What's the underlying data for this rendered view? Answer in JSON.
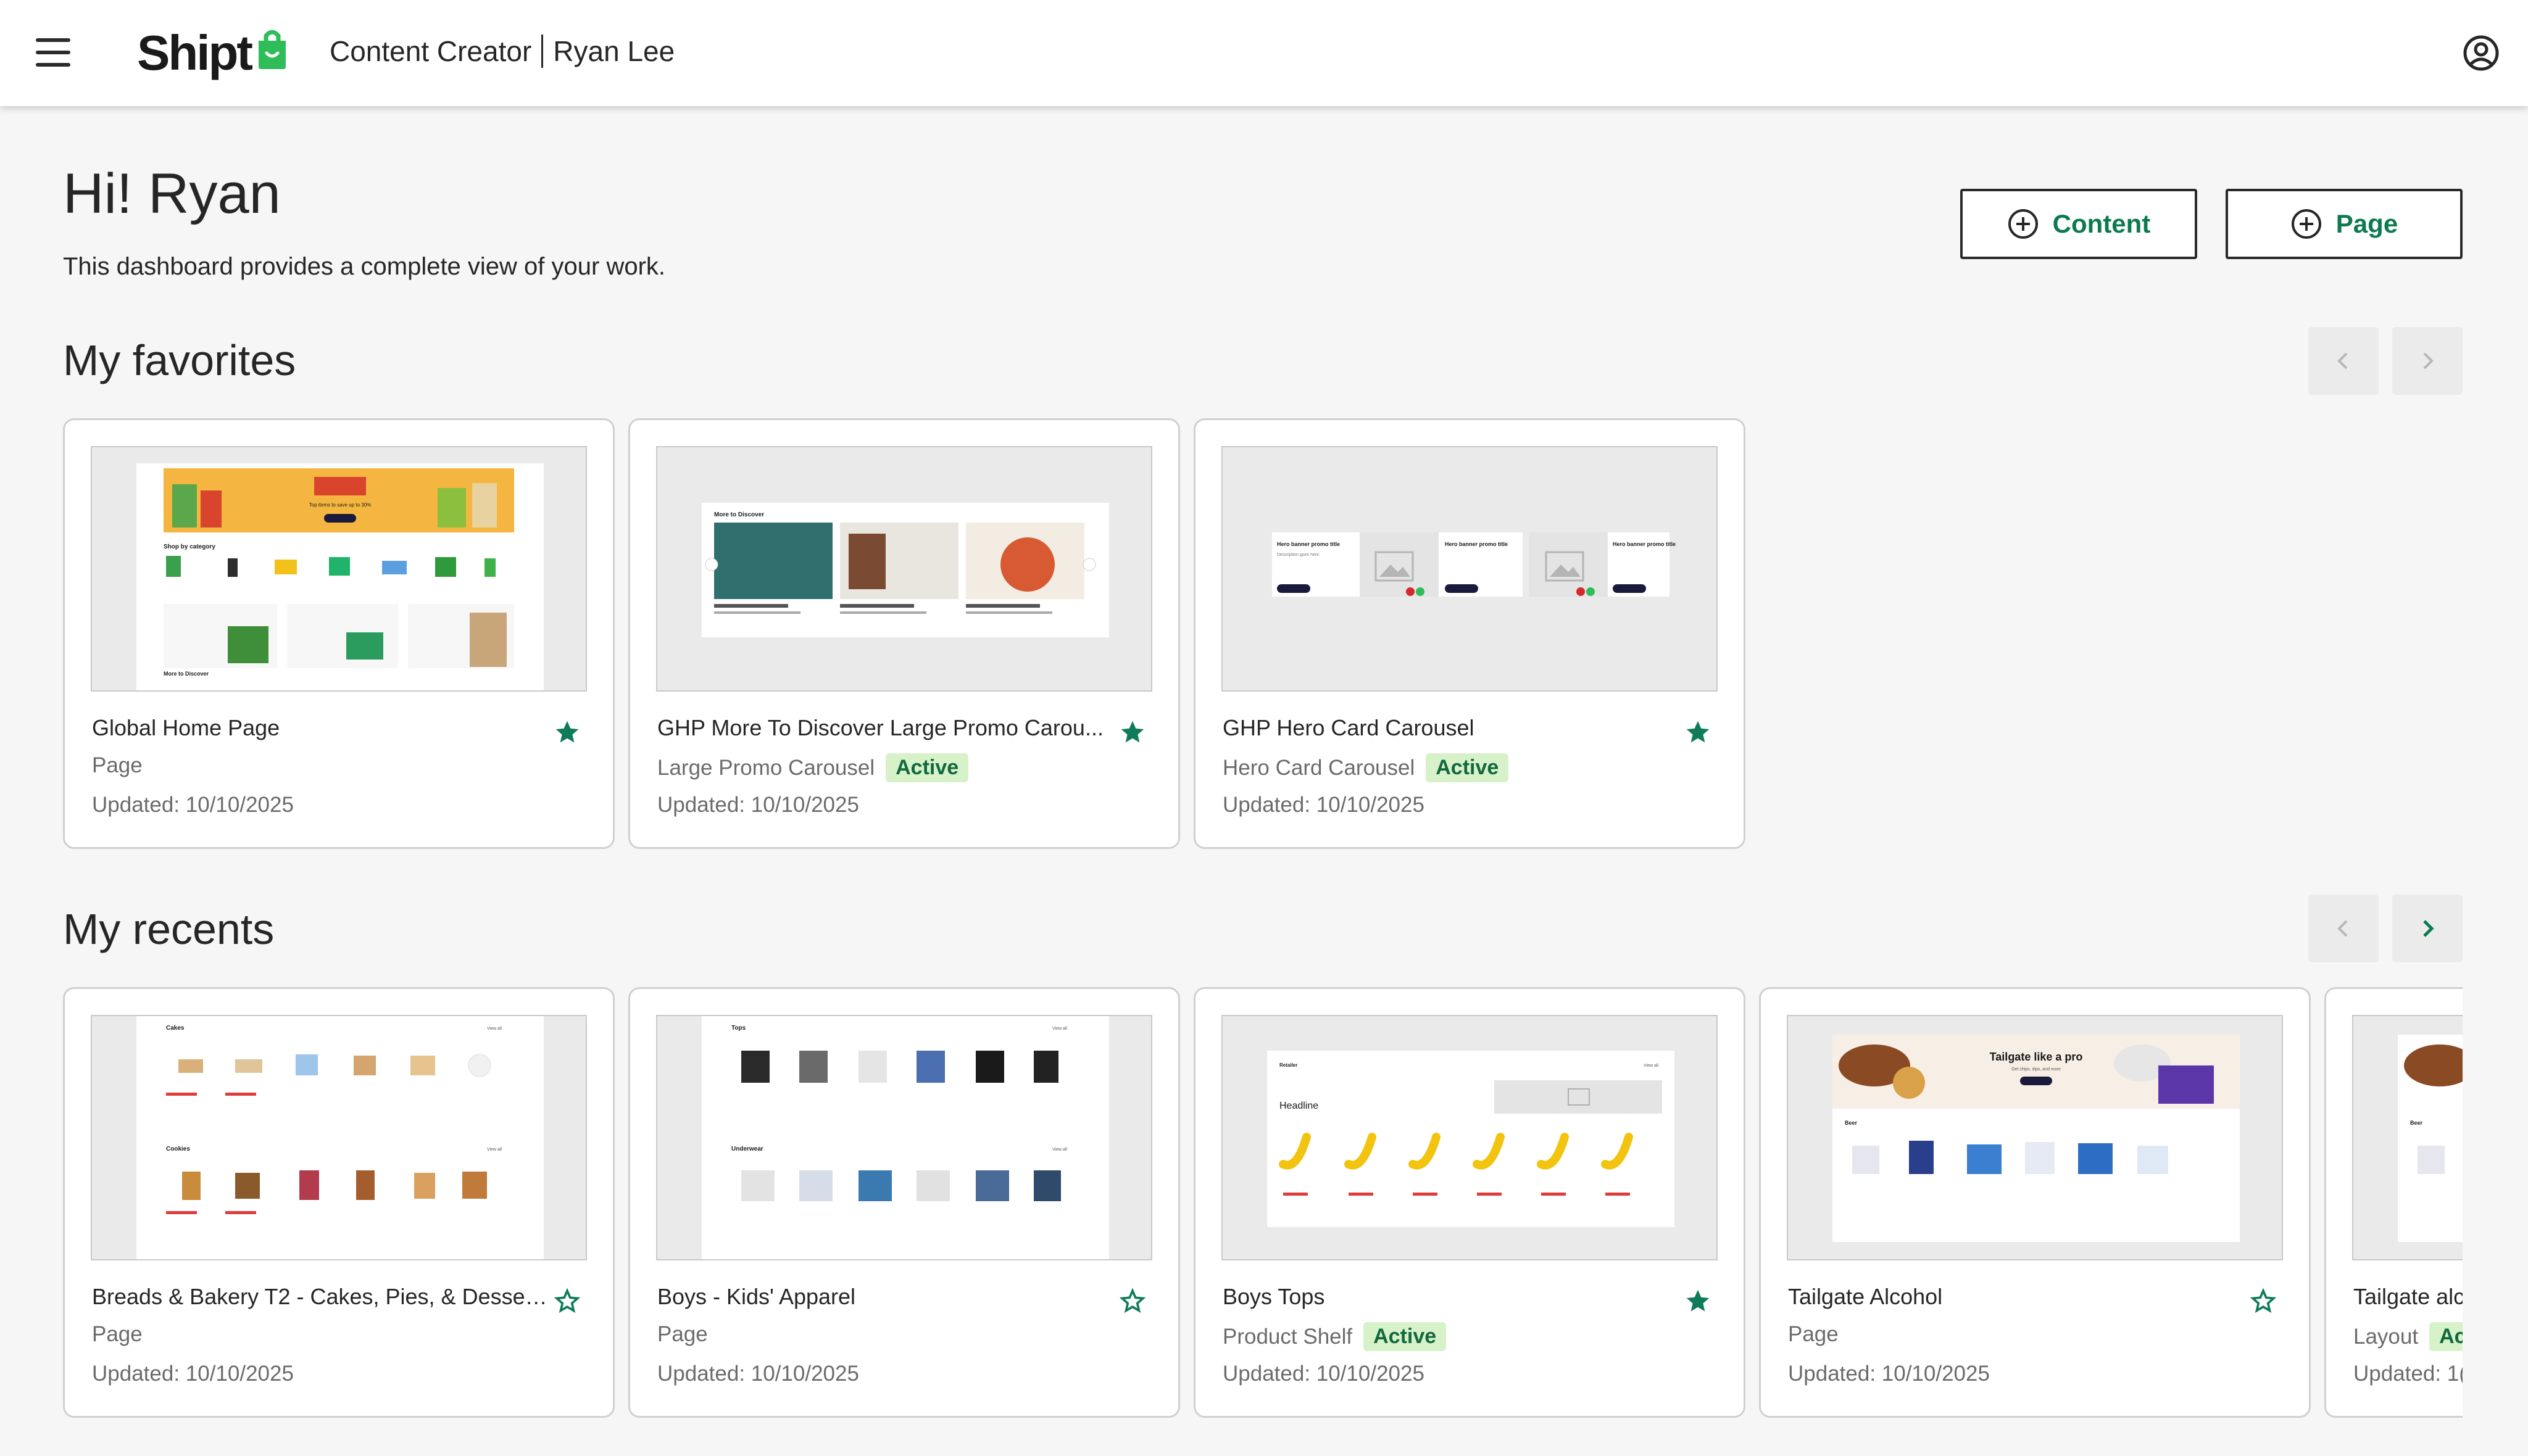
{
  "header": {
    "brand": "Shipt",
    "app_name": "Content Creator",
    "user_name": "Ryan Lee"
  },
  "intro": {
    "greeting": "Hi! Ryan",
    "subtitle": "This dashboard provides a complete view of your work."
  },
  "actions": {
    "content_label": "Content",
    "page_label": "Page"
  },
  "colors": {
    "accent_green": "#0b7a4e",
    "star_green": "#0f7b5a",
    "badge_bg": "#d7f2c9"
  },
  "favorites": {
    "title": "My favorites",
    "cards": [
      {
        "title": "Global Home Page",
        "type": "Page",
        "status": "",
        "updated": "Updated: 10/10/2025",
        "favorited": true
      },
      {
        "title": "GHP More To Discover Large Promo Carou...",
        "type": "Large Promo Carousel",
        "status": "Active",
        "updated": "Updated: 10/10/2025",
        "favorited": true
      },
      {
        "title": "GHP Hero Card Carousel",
        "type": "Hero Card Carousel",
        "status": "Active",
        "updated": "Updated: 10/10/2025",
        "favorited": true
      }
    ]
  },
  "recents": {
    "title": "My recents",
    "cards": [
      {
        "title": "Breads & Bakery T2 - Cakes, Pies, & Desserts",
        "type": "Page",
        "status": "",
        "updated": "Updated: 10/10/2025",
        "favorited": false
      },
      {
        "title": "Boys - Kids' Apparel",
        "type": "Page",
        "status": "",
        "updated": "Updated: 10/10/2025",
        "favorited": false
      },
      {
        "title": "Boys Tops",
        "type": "Product Shelf",
        "status": "Active",
        "updated": "Updated: 10/10/2025",
        "favorited": true
      },
      {
        "title": "Tailgate Alcohol",
        "type": "Page",
        "status": "",
        "updated": "Updated: 10/10/2025",
        "favorited": false
      },
      {
        "title": "Tailgate alc",
        "type": "Layout",
        "status": "Ac",
        "updated": "Updated: 1(",
        "favorited": false
      }
    ]
  },
  "thumbs": {
    "ghp_promo_banner": "Top items to save up to 30%",
    "ghp_shop_by_category": "Shop by category",
    "ghp_more_to_discover": "More to Discover",
    "more_to_discover_header": "More to Discover",
    "hero_banner_title": "Hero banner promo title",
    "hero_banner_desc": "Description goes here.",
    "shop_now": "Shop now",
    "cakes_header": "Cakes",
    "cookies_header": "Cookies",
    "tops_header": "Tops",
    "underwear_header": "Underwear",
    "view_all": "View all",
    "shelf_retailer": "Retailer",
    "shelf_headline": "Headline",
    "tailgate_headline": "Tailgate like a pro",
    "tailgate_beer": "Beer",
    "tailgate_sub": "Get chips, dips, and more"
  }
}
